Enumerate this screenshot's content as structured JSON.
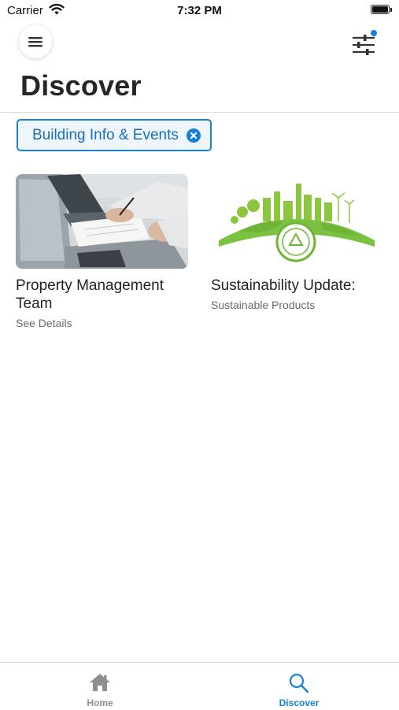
{
  "status": {
    "carrier": "Carrier",
    "time": "7:32 PM"
  },
  "header": {
    "title": "Discover",
    "menu_icon": "hamburger-icon",
    "filter_icon": "sliders-icon"
  },
  "filters": [
    {
      "label": "Building Info & Events",
      "icon": "close-circle-icon"
    }
  ],
  "cards": [
    {
      "title": "Property Management Team",
      "subtitle": "See Details",
      "image": "office-meeting-photo"
    },
    {
      "title": "Sustainability Update:",
      "subtitle": "Sustainable Products",
      "image": "green-earth-city-illustration"
    }
  ],
  "tabbar": {
    "items": [
      {
        "label": "Home",
        "icon": "home-icon",
        "active": false
      },
      {
        "label": "Discover",
        "icon": "search-icon",
        "active": true
      }
    ]
  },
  "colors": {
    "accent": "#1a7fd6",
    "inactive": "#8e8e8e",
    "green": "#7cc242"
  }
}
